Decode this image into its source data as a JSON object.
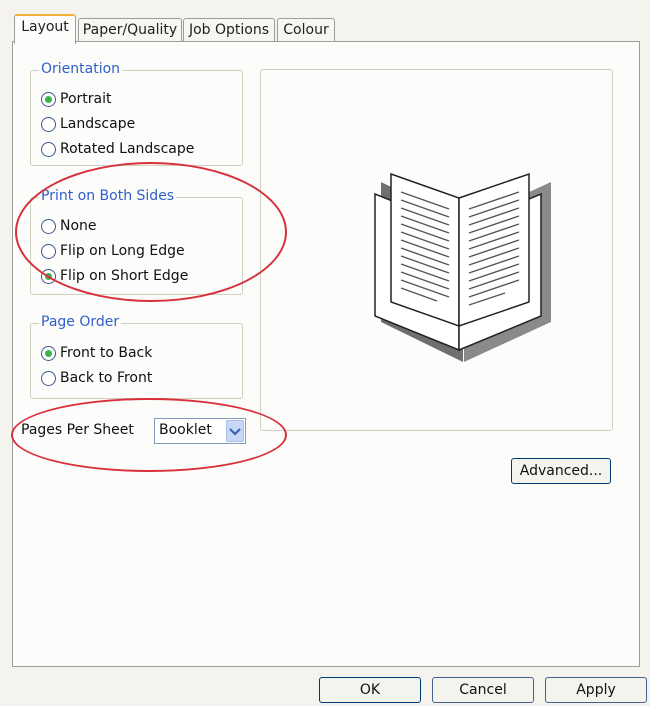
{
  "tabs": [
    {
      "label": "Layout"
    },
    {
      "label": "Paper/Quality"
    },
    {
      "label": "Job Options"
    },
    {
      "label": "Colour"
    }
  ],
  "orientation": {
    "title": "Orientation",
    "options": [
      {
        "label": "Portrait",
        "checked": true
      },
      {
        "label": "Landscape",
        "checked": false
      },
      {
        "label": "Rotated Landscape",
        "checked": false
      }
    ]
  },
  "both_sides": {
    "title": "Print on Both Sides",
    "options": [
      {
        "label": "None",
        "checked": false
      },
      {
        "label": "Flip on Long Edge",
        "checked": false
      },
      {
        "label": "Flip on Short Edge",
        "checked": true
      }
    ]
  },
  "page_order": {
    "title": "Page Order",
    "options": [
      {
        "label": "Front to Back",
        "checked": true
      },
      {
        "label": "Back to Front",
        "checked": false
      }
    ]
  },
  "pages_per_sheet": {
    "label": "Pages Per Sheet",
    "value": "Booklet"
  },
  "buttons": {
    "advanced": "Advanced...",
    "ok": "OK",
    "cancel": "Cancel",
    "apply": "Apply"
  },
  "icons": {
    "preview": "open-booklet-icon",
    "dropdown": "chevron-down-icon"
  },
  "colors": {
    "group_title": "#2f5fc9",
    "radio_checked": "#3bb34a",
    "highlight_ellipse": "#d7303a"
  }
}
